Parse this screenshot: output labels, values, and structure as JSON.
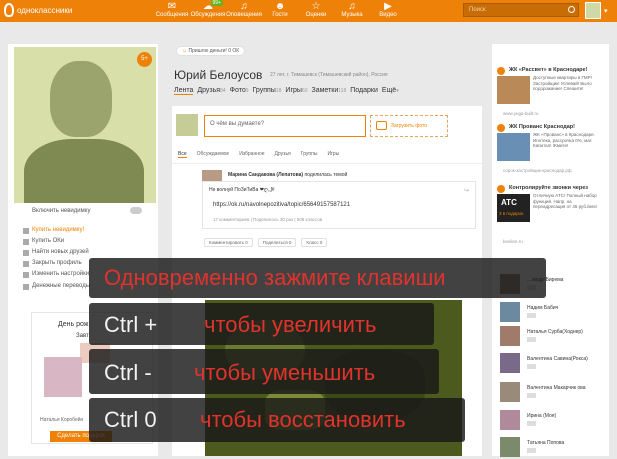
{
  "topbar": {
    "logo": "одноклассники",
    "nav": [
      {
        "label": "Сообщения",
        "icon": "envelope-icon",
        "glyph": "✉",
        "badge": ""
      },
      {
        "label": "Обсуждения",
        "icon": "chat-icon",
        "glyph": "☁",
        "badge": "99+"
      },
      {
        "label": "Оповещения",
        "icon": "bell-icon",
        "glyph": "♫",
        "badge": ""
      },
      {
        "label": "Гости",
        "icon": "footprint-icon",
        "glyph": "☻",
        "badge": ""
      },
      {
        "label": "Оценки",
        "icon": "star-icon",
        "glyph": "☆",
        "badge": ""
      },
      {
        "label": "Музыка",
        "icon": "music-icon",
        "glyph": "♫",
        "badge": ""
      },
      {
        "label": "Видео",
        "icon": "video-icon",
        "glyph": "▶",
        "badge": ""
      }
    ],
    "search_placeholder": "Поиск"
  },
  "left": {
    "age_badge": "5+",
    "invisible": "Включить невидимку",
    "links": [
      "Купить невидимку!",
      "Купить ОКи",
      "Найти новых друзей",
      "Закрыть профиль",
      "Изменить настройки",
      "Денежные переводы"
    ],
    "birthday_title": "День рож",
    "birthday_sub": "Завт",
    "birthday_name": "Наталья Коробейн",
    "birthday_button": "Сделать подарок"
  },
  "profile": {
    "mood": "Пришлю деньги! 0 ОК",
    "name": "Юрий Белоусов",
    "info": "27 лет, г. Тимашевск (Тимашевский район), Россия",
    "tabs": [
      {
        "label": "Лента",
        "count": ""
      },
      {
        "label": "Друзья",
        "count": "84"
      },
      {
        "label": "Фото",
        "count": "9"
      },
      {
        "label": "Группы",
        "count": "18"
      },
      {
        "label": "Игры",
        "count": "60"
      },
      {
        "label": "Заметки",
        "count": "118"
      },
      {
        "label": "Подарки",
        "count": ""
      },
      {
        "label": "Ещё",
        "count": "▾"
      }
    ]
  },
  "composer": {
    "placeholder": "О чём вы думаете?",
    "upload": "Загрузить фото"
  },
  "feed": {
    "tabs": [
      "Все",
      "Обсуждаемое",
      "Избранное",
      "Друзья",
      "Группы",
      "Игры"
    ],
    "post_author": "Марина Сандакова (Лепатова)",
    "post_action": "поделилась темой",
    "share_title": "Не волнуй ПоЗиТиВа ❤ღ,,ʃ#",
    "share_link": "https://ok.ru/navolnepozitiva/topic/65649157587121",
    "share_meta": "17 комментариев  |  Поделилось 30 раз  |  508 классов",
    "actions": [
      "Комментировать  0",
      "Поделиться  0",
      "Класс  0"
    ]
  },
  "right": {
    "ads": [
      {
        "title": "ЖК «Рассвет» в Краснодаре!",
        "desc": "Доступные квартиры в ГМР! Застройщик! Успевай! Было подорожание! Спешите!",
        "src": "www.yuga-built.ru"
      },
      {
        "title": "ЖК Прованс Краснодар!",
        "desc": "ЖК «Прованс» в Краснодаре. Ипотека, рассрочка 0%, мат. Капитал! Жмите!",
        "src": "сорок-застройщик-краснодар.рф"
      },
      {
        "title": "Контролируйте звонки через",
        "desc": "Отличную АТС! Полный набор функций. Напр. на переадресация от 45 руб./мес!",
        "src": "beeline.ru"
      }
    ],
    "ad_badge": "ATC",
    "ad_badge2": "3 в подарок",
    "friends": [
      "…мидр-Бирема",
      "Надим Бабич",
      "Наталья Сурба(Ходнер)",
      "Валентина Савина(Рокса)",
      "Валентина Макарчик ова",
      "Ирина (Моя)",
      "Татьяна Попова"
    ]
  },
  "overlay": {
    "line1": "Одновременно зажмите клавиши",
    "row2_key": "Ctrl +",
    "row2_text": "чтобы увеличить",
    "row3_key": "Ctrl -",
    "row3_text": "чтобы уменьшить",
    "row4_key": "Ctrl 0",
    "row4_text": "чтобы восстановить"
  }
}
